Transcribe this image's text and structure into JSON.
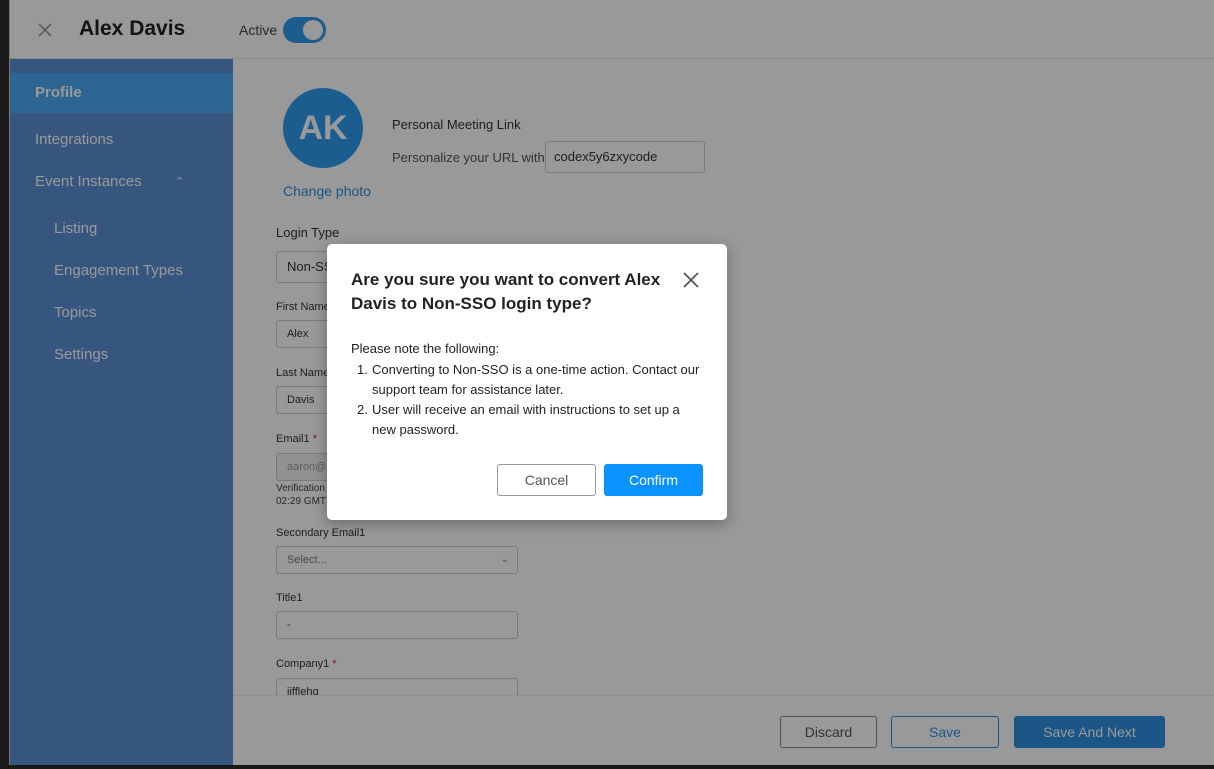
{
  "header": {
    "title": "Alex Davis",
    "active_label": "Active",
    "active_toggle_on": true
  },
  "sidebar": {
    "items": [
      {
        "label": "Profile",
        "selected": true
      },
      {
        "label": "Integrations"
      },
      {
        "label": "Event Instances",
        "expanded": true
      },
      {
        "label": "Listing"
      },
      {
        "label": "Engagement Types"
      },
      {
        "label": "Topics"
      },
      {
        "label": "Settings"
      }
    ]
  },
  "profile": {
    "avatar_initials": "AK",
    "change_photo": "Change photo",
    "personal_meeting_link_label": "Personal Meeting Link",
    "personalize_label": "Personalize your URL with",
    "url_value": "codex5y6zxycode"
  },
  "form": {
    "login_type_label": "Login Type",
    "login_type_value": "Non-SSO",
    "first_name_label": "First Name",
    "first_name_value": "Alex",
    "last_name_label": "Last Name",
    "last_name_value": "Davis",
    "email_label": "Email1",
    "email_value": "aaron@j",
    "verification_text": "Verification",
    "verification_time": "02:29 GMT",
    "secondary_email_label": "Secondary Email1",
    "secondary_email_placeholder": "Select...",
    "title_label": "Title1",
    "title_value": "-",
    "company_label": "Company1",
    "company_value": "jifflehq",
    "required_mark": "*"
  },
  "footer": {
    "discard": "Discard",
    "save": "Save",
    "save_and_next": "Save And Next"
  },
  "dialog": {
    "title": "Are you sure you want to convert Alex Davis to Non-SSO login type?",
    "note": "Please note the following:",
    "items": [
      {
        "num": "1.",
        "text": "Converting to Non-SSO is a one-time action. Contact our support team for assistance later."
      },
      {
        "num": "2.",
        "text": "User will receive an email with instructions to set up a new password."
      }
    ],
    "cancel": "Cancel",
    "confirm": "Confirm"
  },
  "colors": {
    "accent": "#2f8fe0",
    "sidebar": "#5b8fd6",
    "sidebar_selected": "#4aa8f2",
    "confirm": "#0a93ff"
  }
}
